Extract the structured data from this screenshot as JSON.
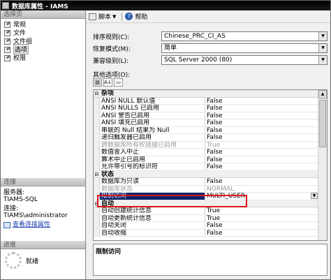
{
  "window": {
    "title": "数据库属性 - IAMS"
  },
  "left": {
    "select_page_header": "选择页",
    "pages": [
      {
        "label": "常规"
      },
      {
        "label": "文件"
      },
      {
        "label": "文件组"
      },
      {
        "label": "选项"
      },
      {
        "label": "权限"
      }
    ],
    "connection_header": "连接",
    "server_label": "服务器:",
    "server_value": "TIAMS-SQL",
    "connection_label": "连接:",
    "connection_value": "TIAMS\\administrator",
    "view_connection_link": "查看连接属性",
    "progress_header": "进度",
    "progress_status": "就绪"
  },
  "toolbar": {
    "script_label": "脚本",
    "help_label": "帮助"
  },
  "form": {
    "collation_label": "排序规则(C):",
    "collation_value": "Chinese_PRC_CI_AS",
    "recovery_label": "恢复模式(M):",
    "recovery_value": "简单",
    "compat_label": "兼容级别(L):",
    "compat_value": "SQL Server 2000 (80)",
    "other_options_label": "其他选项(O):"
  },
  "grid": {
    "rows": [
      {
        "type": "cat",
        "name": "杂项"
      },
      {
        "name": "ANSI NULL 默认值",
        "value": "False"
      },
      {
        "name": "ANSI NULLS 已启用",
        "value": "False"
      },
      {
        "name": "ANSI 警告已启用",
        "value": "False"
      },
      {
        "name": "ANSI 填充已启用",
        "value": "False"
      },
      {
        "name": "串联的 Null 结果为 Null",
        "value": "False"
      },
      {
        "name": "递归触发器已启用",
        "value": "False"
      },
      {
        "name": "跨数据库所有权链接已启用",
        "value": "True",
        "disabled": true
      },
      {
        "name": "数值舍入中止",
        "value": "False"
      },
      {
        "name": "算术中止已启用",
        "value": "False"
      },
      {
        "name": "允许带引号的标识符",
        "value": "False"
      },
      {
        "type": "cat",
        "name": "状态"
      },
      {
        "name": "数据库为只读",
        "value": "False"
      },
      {
        "name": "数据库状态",
        "value": "NORMAL",
        "disabled": true
      },
      {
        "name": "限制访问",
        "value": "MULTI_USER",
        "selected": true
      },
      {
        "type": "cat",
        "name": "自动"
      },
      {
        "name": "自动创建统计信息",
        "value": "True"
      },
      {
        "name": "自动更新统计信息",
        "value": "True"
      },
      {
        "name": "自动关闭",
        "value": "False"
      },
      {
        "name": "自动收缩",
        "value": "False"
      }
    ]
  },
  "description": {
    "title": "限制访问"
  }
}
